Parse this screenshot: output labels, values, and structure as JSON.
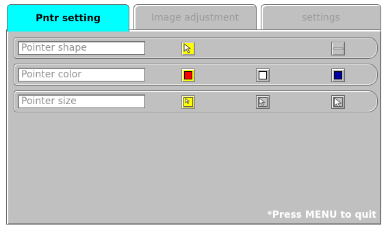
{
  "tabs": [
    {
      "label": "Pntr setting",
      "active": true
    },
    {
      "label": "Image adjustment",
      "active": false
    },
    {
      "label": "settings",
      "active": false
    }
  ],
  "rows": {
    "shape": {
      "label": "Pointer shape",
      "options": [
        {
          "icon": "arrow-pointer-icon",
          "selected": true
        },
        {
          "icon": "bar-pointer-icon",
          "selected": false
        }
      ]
    },
    "color": {
      "label": "Pointer color",
      "options": [
        {
          "icon": "red-swatch-icon",
          "color": "#ff0000",
          "selected": true
        },
        {
          "icon": "white-swatch-icon",
          "color": "#ffffff",
          "selected": false
        },
        {
          "icon": "blue-swatch-icon",
          "color": "#0000a0",
          "selected": false
        }
      ]
    },
    "size": {
      "label": "Pointer size",
      "options": [
        {
          "icon": "small-pointer-icon",
          "selected": true
        },
        {
          "icon": "medium-pointer-icon",
          "selected": false
        },
        {
          "icon": "large-pointer-icon",
          "selected": false
        }
      ]
    }
  },
  "footer": {
    "hint": "*Press MENU to quit"
  },
  "colors": {
    "active_tab": "#00ffff",
    "panel": "#c0c0c0",
    "selected": "#ffff00"
  }
}
